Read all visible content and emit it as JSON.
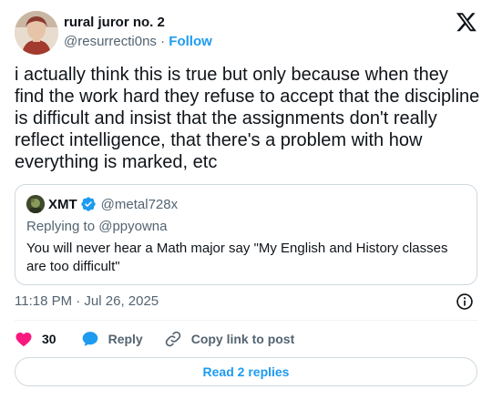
{
  "author": {
    "name": "rural juror no. 2",
    "handle": "@resurrecti0ns",
    "separator": "·",
    "follow_label": "Follow"
  },
  "tweet": {
    "text": "i actually think this is true but only because when they find the work hard they refuse to accept that the discipline is difficult and insist that the assignments don't really reflect intelligence, that there's a problem with how everything is marked, etc"
  },
  "quoted_tweet": {
    "name": "XMT",
    "handle": "@metal728x",
    "replying_to": "Replying to @ppyowna",
    "text": "You will never hear a Math major say \"My English and History classes are too difficult\""
  },
  "timestamp": "11:18 PM · Jul 26, 2025",
  "actions": {
    "likes_count": "30",
    "reply_label": "Reply",
    "copy_link_label": "Copy link to post"
  },
  "read_replies_label": "Read 2 replies",
  "colors": {
    "accent": "#1d9bf0",
    "like": "#f91880",
    "text": "#0f1419",
    "secondary": "#536471",
    "border": "#cfd9de"
  },
  "icons": [
    "x-logo-icon",
    "verified-badge-icon",
    "info-icon",
    "heart-icon",
    "reply-bubble-icon",
    "link-icon"
  ]
}
